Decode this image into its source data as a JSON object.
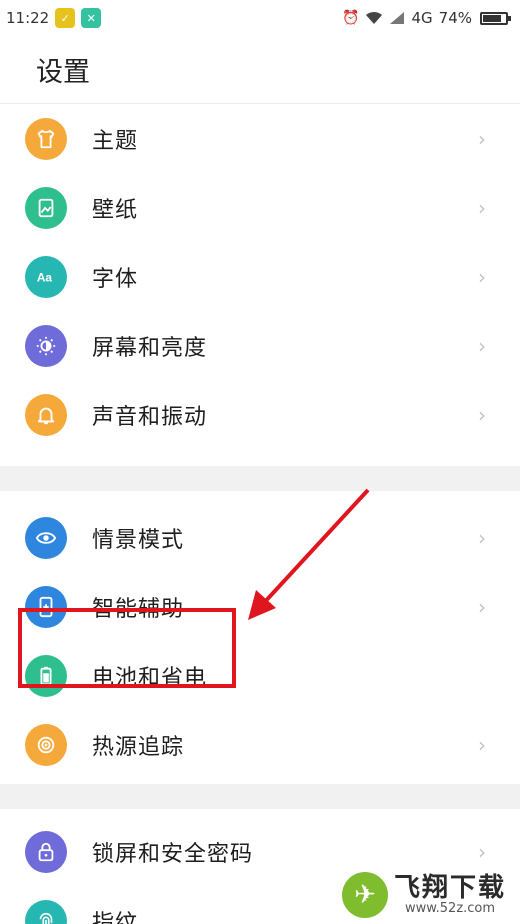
{
  "status_bar": {
    "time": "11:22",
    "network": "4G",
    "battery": "74%",
    "battery_level": 0.74
  },
  "header": {
    "title": "设置"
  },
  "sections": [
    {
      "items": [
        {
          "label": "主题",
          "icon": "theme-shirt-icon",
          "color": "#f4a93a"
        },
        {
          "label": "壁纸",
          "icon": "wallpaper-icon",
          "color": "#2fbf8f"
        },
        {
          "label": "字体",
          "icon": "font-icon",
          "color": "#27b7b2"
        },
        {
          "label": "屏幕和亮度",
          "icon": "brightness-icon",
          "color": "#6f6bd9"
        },
        {
          "label": "声音和振动",
          "icon": "bell-icon",
          "color": "#f4a93a"
        }
      ]
    },
    {
      "items": [
        {
          "label": "情景模式",
          "icon": "eye-icon",
          "color": "#2e86de"
        },
        {
          "label": "智能辅助",
          "icon": "assist-phone-icon",
          "color": "#2e86de"
        },
        {
          "label": "电池和省电",
          "icon": "battery-icon",
          "color": "#2fbf8f"
        },
        {
          "label": "热源追踪",
          "icon": "heat-icon",
          "color": "#f4a93a"
        }
      ]
    },
    {
      "items": [
        {
          "label": "锁屏和安全密码",
          "icon": "lock-icon",
          "color": "#6f6bd9"
        },
        {
          "label": "指纹",
          "icon": "fingerprint-icon",
          "color": "#27b7b2"
        }
      ]
    }
  ],
  "chevron": "›",
  "watermark": {
    "title": "飞翔下载",
    "url": "www.52z.com"
  },
  "annotation_color": "#e0161f"
}
